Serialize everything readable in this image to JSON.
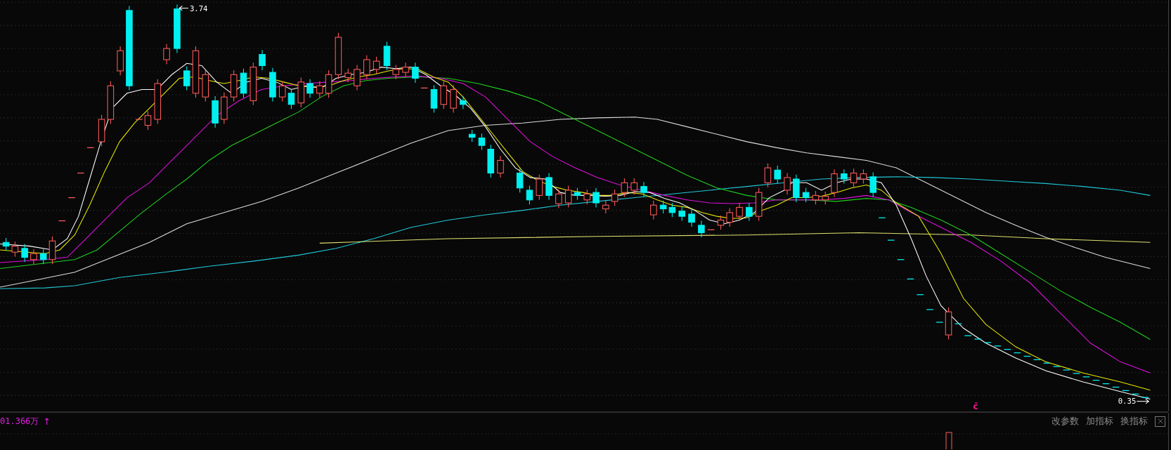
{
  "chart": {
    "high_label": "3.74",
    "low_label": "0.35",
    "signal_mark": "ĉ"
  },
  "indicator": {
    "reading": "01.366万",
    "trend_arrow": "↑",
    "buttons": [
      {
        "label": "改参数"
      },
      {
        "label": "加指标"
      },
      {
        "label": "换指标"
      }
    ]
  }
}
